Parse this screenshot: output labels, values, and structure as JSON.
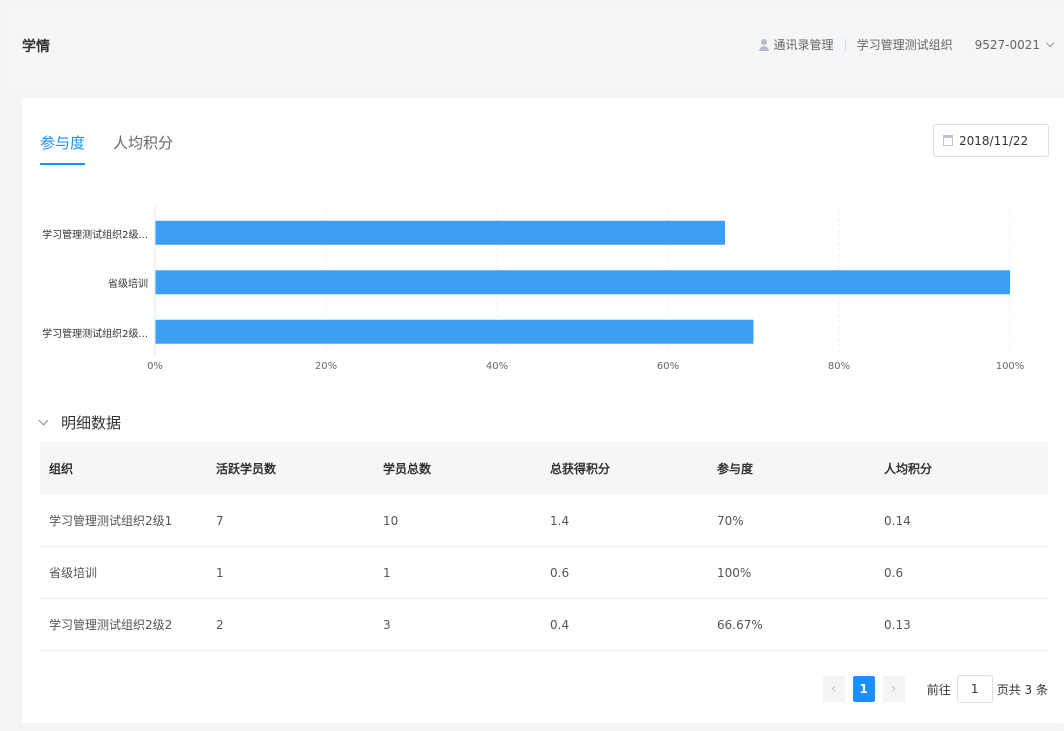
{
  "header": {
    "title": "学情",
    "contacts_label": "通讯录管理",
    "org_name": "学习管理测试组织",
    "account_id": "9527-0021"
  },
  "tabs": [
    {
      "label": "参与度",
      "active": true
    },
    {
      "label": "人均积分",
      "active": false
    }
  ],
  "date_picker": {
    "value": "2018/11/22"
  },
  "chart_data": {
    "type": "bar",
    "orientation": "horizontal",
    "categories": [
      "学习管理测试组织2级...",
      "省级培训",
      "学习管理测试组织2级..."
    ],
    "values": [
      66.67,
      100,
      70
    ],
    "x_ticks": [
      "0%",
      "20%",
      "40%",
      "60%",
      "80%",
      "100%"
    ],
    "xlim": [
      0,
      100
    ],
    "color": "#3ba0f4",
    "grid": true
  },
  "detail": {
    "title": "明细数据",
    "columns": [
      "组织",
      "活跃学员数",
      "学员总数",
      "总获得积分",
      "参与度",
      "人均积分"
    ],
    "rows": [
      [
        "学习管理测试组织2级1",
        "7",
        "10",
        "1.4",
        "70%",
        "0.14"
      ],
      [
        "省级培训",
        "1",
        "1",
        "0.6",
        "100%",
        "0.6"
      ],
      [
        "学习管理测试组织2级2",
        "2",
        "3",
        "0.4",
        "66.67%",
        "0.13"
      ]
    ]
  },
  "pagination": {
    "prev": "‹",
    "current": "1",
    "next": "›",
    "goto_label": "前往",
    "goto_value": "1",
    "suffix": "页共 3 条"
  },
  "colors": {
    "primary": "#1890ff",
    "bar": "#3ba0f4"
  }
}
